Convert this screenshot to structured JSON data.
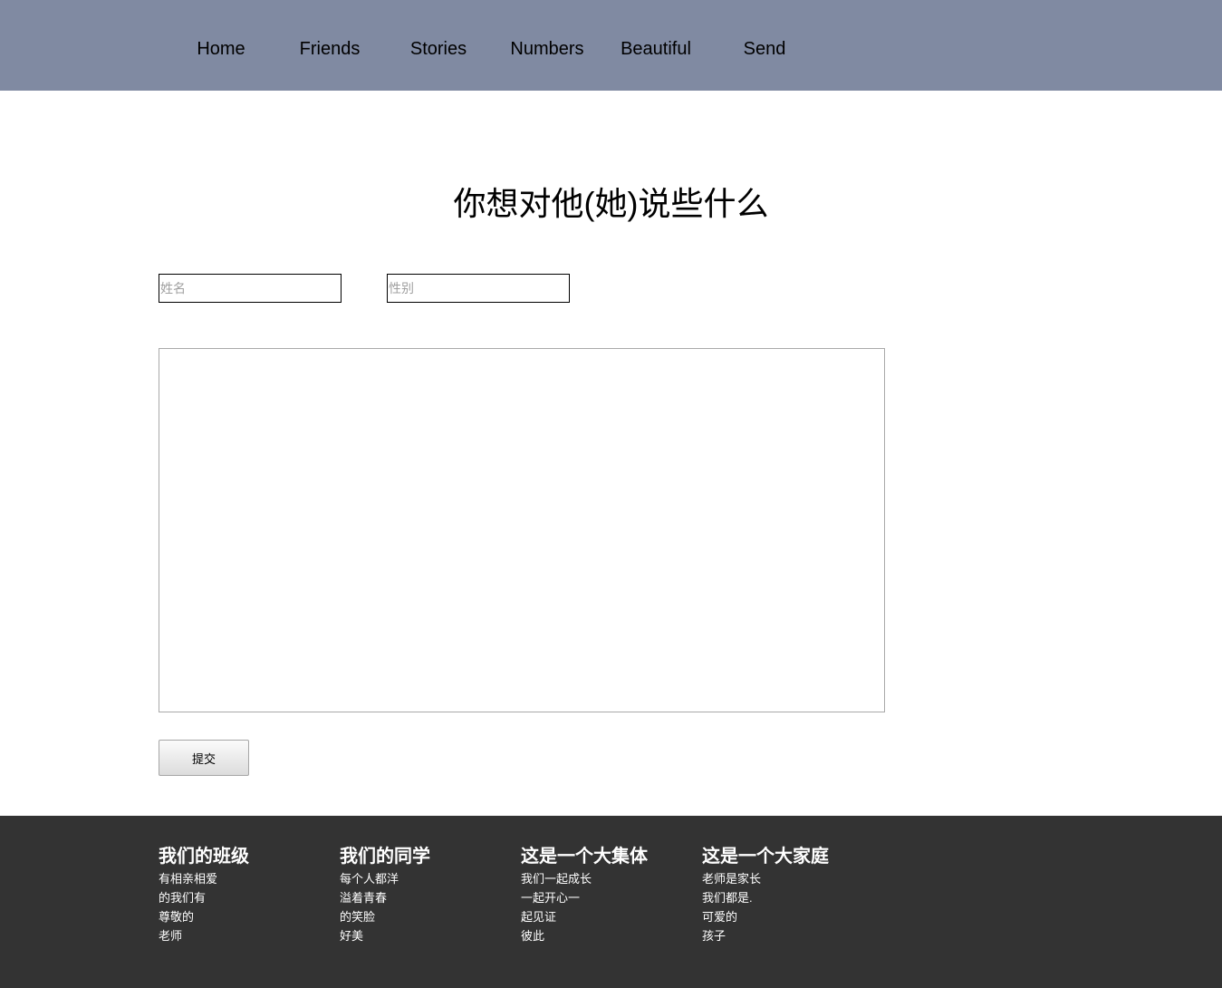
{
  "nav": {
    "items": [
      {
        "label": "Home"
      },
      {
        "label": "Friends"
      },
      {
        "label": "Stories"
      },
      {
        "label": "Numbers"
      },
      {
        "label": "Beautiful"
      },
      {
        "label": "Send"
      }
    ],
    "background": "#808aa2"
  },
  "main": {
    "title": "你想对他(她)说些什么",
    "name_input": {
      "placeholder": "姓名",
      "value": ""
    },
    "gender_input": {
      "placeholder": "性别",
      "value": ""
    },
    "message": {
      "value": ""
    },
    "submit_label": "提交"
  },
  "footer": {
    "background": "#333333",
    "columns": [
      {
        "heading": "我们的班级",
        "lines": [
          "有相亲相爱",
          "的我们有",
          "尊敬的",
          "老师"
        ]
      },
      {
        "heading": "我们的同学",
        "lines": [
          "每个人都洋",
          "溢着青春",
          "的笑脸",
          "好美"
        ]
      },
      {
        "heading": "这是一个大集体",
        "lines": [
          "我们一起成长",
          "一起开心一",
          "起见证",
          "彼此"
        ]
      },
      {
        "heading": "这是一个大家庭",
        "lines": [
          "老师是家长",
          "我们都是.",
          "可爱的",
          "孩子"
        ]
      }
    ]
  }
}
